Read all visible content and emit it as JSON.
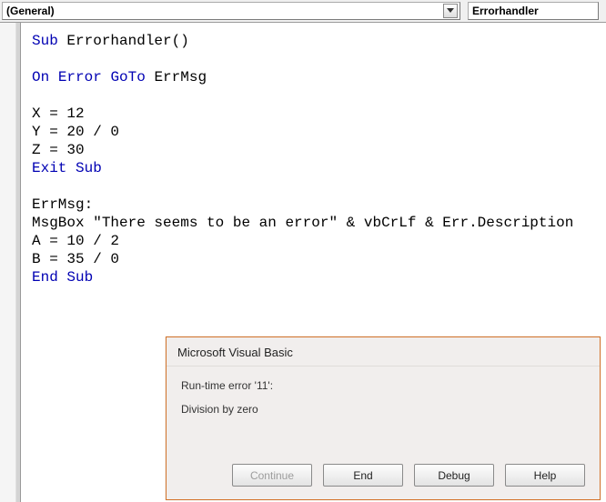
{
  "dropdowns": {
    "object": "(General)",
    "procedure": "Errorhandler"
  },
  "code": {
    "l1a": "Sub",
    "l1b": " Errorhandler()",
    "l2a": "On",
    "l2b": " ",
    "l2c": "Error",
    "l2d": " ",
    "l2e": "GoTo",
    "l2f": " ErrMsg",
    "l3": "X = 12",
    "l4": "Y = 20 / 0",
    "l5": "Z = 30",
    "l6a": "Exit",
    "l6b": " ",
    "l6c": "Sub",
    "l7": "ErrMsg:",
    "l8": "MsgBox \"There seems to be an error\" & vbCrLf & Err.Description",
    "l9": "A = 10 / 2",
    "l10": "B = 35 / 0",
    "l11a": "End",
    "l11b": " ",
    "l11c": "Sub"
  },
  "dialog": {
    "title": "Microsoft Visual Basic",
    "error_line": "Run-time error '11':",
    "error_desc": "Division by zero",
    "buttons": {
      "continue": "Continue",
      "end": "End",
      "debug": "Debug",
      "help": "Help"
    }
  }
}
